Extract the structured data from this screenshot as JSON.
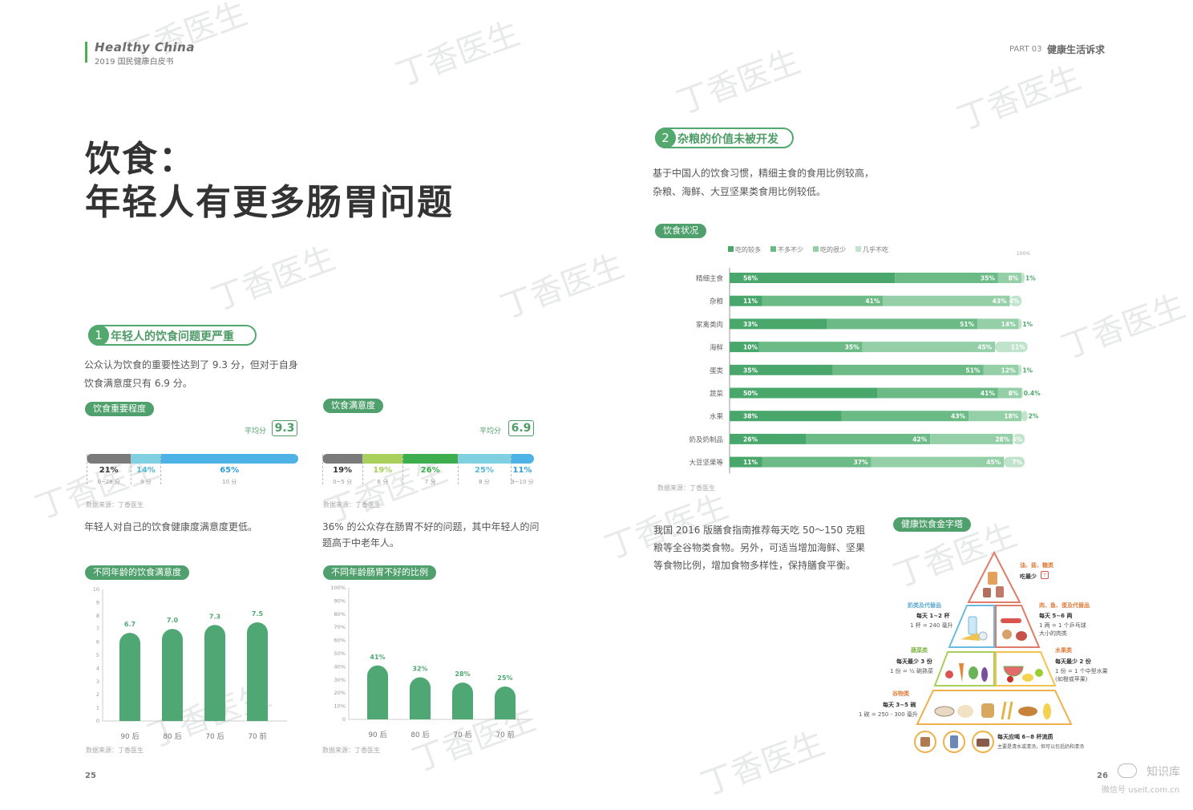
{
  "header": {
    "brand_title": "Healthy China",
    "brand_subtitle": "2019 国民健康白皮书",
    "part_num": "PART 03",
    "part_title": "健康生活诉求"
  },
  "title": {
    "line1": "饮食：",
    "line2": "年轻人有更多肠胃问题"
  },
  "section1": {
    "num": "1",
    "heading": "年轻人的饮食问题更严重",
    "para": "公众认为饮食的重要性达到了 9.3 分，但对于自身饮食满意度只有 6.9 分。",
    "para_l1": "公众认为饮食的重要性达到了 9.3 分，但对于自身",
    "para_l2": "饮食满意度只有 6.9 分。"
  },
  "section2": {
    "num": "2",
    "heading": "杂粮的价值未被开发",
    "para_l1": "基于中国人的饮食习惯，精细主食的食用比例较高，",
    "para_l2": "杂粮、海鲜、大豆坚果类食用比例较低。"
  },
  "importance": {
    "tag": "饮食重要程度",
    "avg_label": "平均分",
    "avg": "9.3",
    "source": "数据来源：丁香医生",
    "colors": [
      "#7b7b7b",
      "#7fd0e0",
      "#4db3e6"
    ],
    "segments": [
      {
        "pct": "21%",
        "range": "0~28 分",
        "value": 21
      },
      {
        "pct": "14%",
        "range": "9 分",
        "value": 14
      },
      {
        "pct": "65%",
        "range": "10 分",
        "value": 65
      }
    ]
  },
  "satisfaction": {
    "tag": "饮食满意度",
    "avg_label": "平均分",
    "avg": "6.9",
    "source": "数据来源：丁香医生",
    "colors": [
      "#7b7b7b",
      "#a8d05a",
      "#3dae4e",
      "#7fd0e0",
      "#4db3e6"
    ],
    "segments": [
      {
        "pct": "19%",
        "range": "0~5 分",
        "value": 19
      },
      {
        "pct": "19%",
        "range": "6 分",
        "value": 19
      },
      {
        "pct": "26%",
        "range": "7 分",
        "value": 26
      },
      {
        "pct": "25%",
        "range": "8 分",
        "value": 25
      },
      {
        "pct": "11%",
        "range": "9~10 分",
        "value": 11
      }
    ]
  },
  "note_left": "年轻人对自己的饮食健康度满意度更低。",
  "note_right_l1": "36% 的公众存在肠胃不好的问题，其中年轻人的问",
  "note_right_l2": "题高于中老年人。",
  "chart_data": [
    {
      "type": "bar",
      "tag": "不同年龄的饮食满意度",
      "categories": [
        "90 后",
        "80 后",
        "70 后",
        "70 前"
      ],
      "values": [
        6.7,
        7.0,
        7.3,
        7.5
      ],
      "value_labels": [
        "6.7",
        "7.0",
        "7.3",
        "7.5"
      ],
      "ylim": [
        0,
        10
      ],
      "yticks": [
        "0",
        "1",
        "2",
        "3",
        "4",
        "5",
        "6",
        "7",
        "8",
        "9",
        "10"
      ],
      "source": "数据来源：丁香医生",
      "color": "#4fa874"
    },
    {
      "type": "bar",
      "tag": "不同年龄肠胃不好的比例",
      "categories": [
        "90 后",
        "80 后",
        "70 后",
        "70 前"
      ],
      "values": [
        41,
        32,
        28,
        25
      ],
      "value_labels": [
        "41%",
        "32%",
        "28%",
        "25%"
      ],
      "ylim": [
        0,
        100
      ],
      "yticks": [
        "0",
        "10%",
        "20%",
        "30%",
        "40%",
        "50%",
        "60%",
        "70%",
        "80%",
        "90%",
        "100%"
      ],
      "source": "数据来源：丁香医生",
      "color": "#4fa874"
    },
    {
      "type": "bar",
      "stacked": true,
      "orientation": "horizontal",
      "tag": "饮食状况",
      "top_label": "100%",
      "legend": [
        "吃的较多",
        "不多不少",
        "吃的很少",
        "几乎不吃"
      ],
      "colors": [
        "#4aa76c",
        "#6cbb87",
        "#94cfa8",
        "#bfe3cb"
      ],
      "categories": [
        "精细主食",
        "杂粮",
        "家禽类肉",
        "海鲜",
        "蛋类",
        "蔬菜",
        "水果",
        "奶及奶制品",
        "大豆坚果等"
      ],
      "series": [
        {
          "name": "吃的较多",
          "values": [
            56,
            11,
            33,
            10,
            35,
            50,
            38,
            26,
            11
          ]
        },
        {
          "name": "不多不少",
          "values": [
            35,
            41,
            51,
            35,
            51,
            41,
            43,
            42,
            37
          ]
        },
        {
          "name": "吃的很少",
          "values": [
            8,
            43,
            14,
            45,
            12,
            8,
            18,
            28,
            45
          ]
        },
        {
          "name": "几乎不吃",
          "values": [
            1,
            4,
            1,
            11,
            1,
            0.4,
            2,
            4,
            7
          ]
        }
      ],
      "labels": [
        [
          "56%",
          "35%",
          "8%",
          "1%"
        ],
        [
          "11%",
          "41%",
          "43%",
          "4%"
        ],
        [
          "33%",
          "51%",
          "14%",
          "1%"
        ],
        [
          "10%",
          "35%",
          "45%",
          "11%"
        ],
        [
          "35%",
          "51%",
          "12%",
          "1%"
        ],
        [
          "50%",
          "41%",
          "8%",
          "0.4%"
        ],
        [
          "38%",
          "43%",
          "18%",
          "2%"
        ],
        [
          "26%",
          "42%",
          "28%",
          "4%"
        ],
        [
          "11%",
          "37%",
          "45%",
          "7%"
        ]
      ],
      "xlim": [
        0,
        100
      ],
      "source": "数据来源：丁香医生"
    }
  ],
  "guideline": {
    "l1": "我国 2016 版膳食指南推荐每天吃 50～150 克粗",
    "l2": "粮等全谷物类食物。另外，可适当增加海鲜、坚果",
    "l3": "等食物比例，增加食物多样性，保持膳食平衡。"
  },
  "pyramid": {
    "tag": "健康饮食金字塔",
    "top_title": "油、盐、糖类",
    "top_sub": "吃最少",
    "milk_title": "奶类及代替品",
    "milk_b": "每天 1~2 杯",
    "milk_g": "1 杯 = 240 毫升",
    "meat_title": "肉、鱼、蛋及代替品",
    "meat_b": "每天 5~6 两",
    "meat_g1": "1 两 = 1 个乒乓球",
    "meat_g2": "大小的肉类",
    "veg_title": "蔬菜类",
    "veg_b": "每天最少 3 份",
    "veg_g": "1 份 = ½ 碗熟菜",
    "fruit_title": "水果类",
    "fruit_b": "每天最少 2 份",
    "fruit_g1": "1 份 = 1 个中型水果",
    "fruit_g2": "(如橙或苹果)",
    "grain_title": "谷物类",
    "grain_b": "每天 3~5 碗",
    "grain_g": "1 碗 = 250 - 300 毫升",
    "water_b": "每天应喝 6~8 杯流质",
    "water_g": "主要是清水或清汤，但可以包括奶和清汤"
  },
  "footer": {
    "page_left": "25",
    "page_right": "26",
    "wechat_name": "知识库",
    "wechat_id": "微信号 useit.com.cn"
  },
  "watermark": "丁香医生"
}
